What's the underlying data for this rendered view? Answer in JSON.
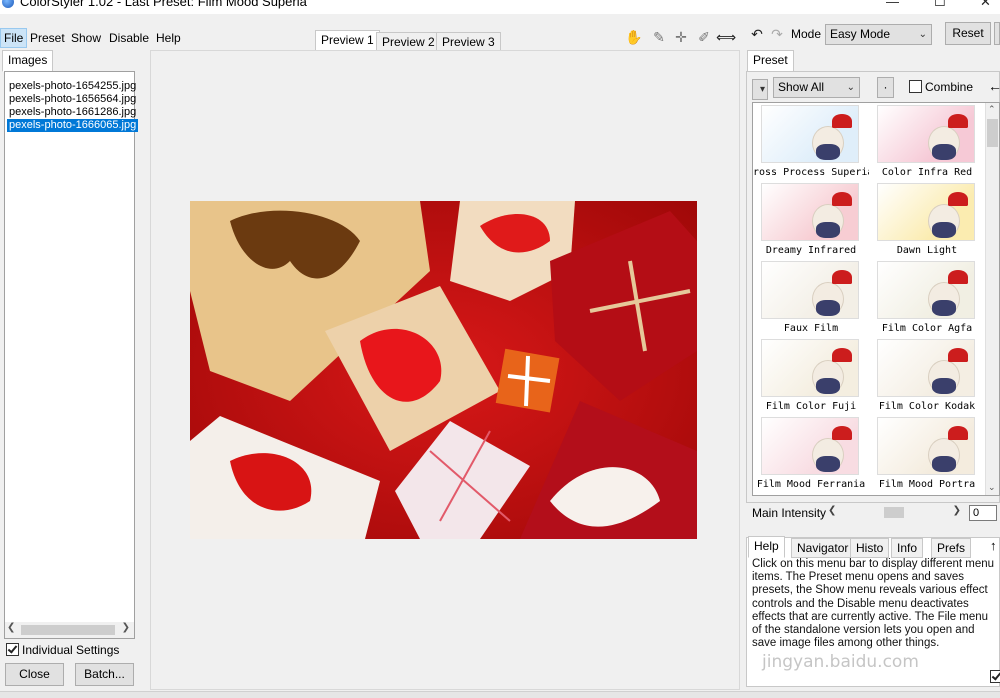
{
  "window": {
    "title": "ColorStyler 1.02 - Last Preset: Film Mood Superia"
  },
  "menu": [
    "File",
    "Preset",
    "Show",
    "Disable",
    "Help"
  ],
  "preview_tabs": [
    "Preview 1",
    "Preview 2",
    "Preview 3"
  ],
  "toolbar": {
    "tools": [
      "hand-icon",
      "eyedropper-icon",
      "crosshair-icon",
      "brush-icon",
      "split-icon"
    ],
    "mode_label": "Mode",
    "mode_value": "Easy Mode",
    "reset_label": "Reset"
  },
  "images_panel": {
    "tab": "Images",
    "files": [
      "pexels-photo-1654255.jpg",
      "pexels-photo-1656564.jpg",
      "pexels-photo-1661286.jpg",
      "pexels-photo-1666065.jpg"
    ],
    "selected_index": 3,
    "individual_settings_label": "Individual Settings",
    "individual_settings_checked": true,
    "close_label": "Close",
    "batch_label": "Batch..."
  },
  "preset_panel": {
    "tab": "Preset",
    "filter_value": "Show All",
    "dot_button": "·",
    "combine_label": "Combine",
    "combine_checked": false,
    "presets": [
      {
        "name": "ross Process Superia",
        "tint": "#dfeefa"
      },
      {
        "name": "Color Infra Red",
        "tint": "#f6c9d6"
      },
      {
        "name": "Dreamy Infrared",
        "tint": "#f7cdd3"
      },
      {
        "name": "Dawn Light",
        "tint": "#fbecb0"
      },
      {
        "name": "Faux Film",
        "tint": "#f3efe6"
      },
      {
        "name": "Film Color Agfa",
        "tint": "#f1efe3"
      },
      {
        "name": "Film Color Fuji",
        "tint": "#f4eee0"
      },
      {
        "name": "Film Color Kodak",
        "tint": "#f4eee3"
      },
      {
        "name": "Film Mood Ferrania",
        "tint": "#f8dce2"
      },
      {
        "name": "Film Mood Portra",
        "tint": "#f4ecde"
      }
    ],
    "intensity_label": "Main Intensity",
    "intensity_value": "0",
    "intensity_level": 0.5
  },
  "info_panel": {
    "tabs": [
      "Help",
      "Navigator",
      "Histo",
      "Info",
      "Prefs"
    ],
    "help_text": "Click on this menu bar to display different menu items. The Preset menu opens and saves presets, the Show menu reveals various effect controls and the Disable menu deactivates effects that are currently active. The File menu of the standalone version lets you open and save image files among other things.",
    "watermark": "jingyan.baidu.com"
  }
}
